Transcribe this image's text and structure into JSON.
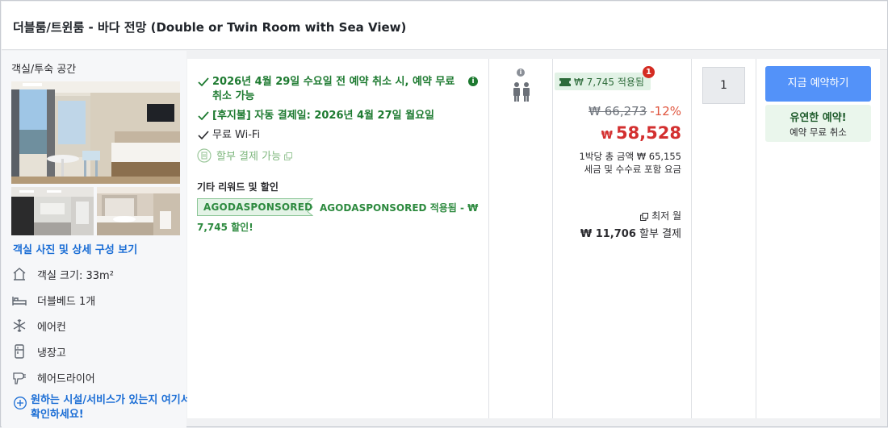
{
  "room": {
    "title": "더블룸/트윈룸 - 바다 전망 (Double or Twin Room with Sea View)",
    "space_label": "객실/투숙 공간",
    "view_photos_link": "객실 사진 및 상세 구성 보기",
    "features": [
      {
        "icon": "house-icon",
        "label": "객실 크기: 33m²"
      },
      {
        "icon": "bed-icon",
        "label": "더블베드 1개"
      },
      {
        "icon": "snowflake-icon",
        "label": "에어컨"
      },
      {
        "icon": "fridge-icon",
        "label": "냉장고"
      },
      {
        "icon": "hairdryer-icon",
        "label": "헤어드라이어"
      }
    ],
    "more_amenities_link": "원하는 시설/서비스가 있는지 여기서 확인하세요!"
  },
  "benefits": {
    "cancel": "2026년 4월 29일 수요일 전 예약 취소 시, 예약 무료 취소 가능",
    "pay_later": "[후지불] 자동 결제일: 2026년 4월 27일 월요일",
    "wifi": "무료 Wi-Fi",
    "installment": "할부 결제 가능",
    "other_label": "기타 리워드 및 할인",
    "promo_code": "AGODASPONSORED",
    "promo_desc": "AGODASPONSORED 적용됨 - ₩ 7,745 할인!"
  },
  "occupancy": {
    "info_icon": "info-icon",
    "people_icon": "two-people-icon"
  },
  "price": {
    "discount_pill": "₩ 7,745 적용됨",
    "notification_count": "1",
    "original": "₩ 66,273",
    "discount_pct": "-12%",
    "currency": "₩",
    "final": "58,528",
    "per_night_total": "1박당 총 금액 ₩ 65,155",
    "tax_note": "세금 및 수수료 포함 요금",
    "min_month": "최저 월",
    "monthly_amount": "₩ 11,706",
    "monthly_suffix": "할부 결제"
  },
  "quantity": {
    "value": "1"
  },
  "booking": {
    "book_now": "지금 예약하기",
    "flex_title": "유연한 예약!",
    "flex_sub": "예약 무료 취소"
  },
  "colors": {
    "accent_blue": "#5392f9",
    "link_blue": "#1a6dd5",
    "green": "#1d7a30",
    "price_red": "#d32f2f"
  }
}
